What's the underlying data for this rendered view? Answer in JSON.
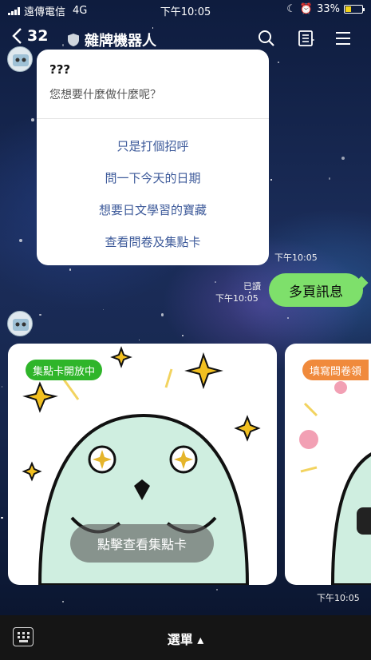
{
  "status": {
    "carrier": "遠傳電信",
    "network": "4G",
    "time": "下午10:05",
    "battery": "33%",
    "battery_fraction": 0.33
  },
  "header": {
    "unread_count": "32",
    "title": "雜牌機器人"
  },
  "quick_reply": {
    "title": "???",
    "subtitle": "您想要什麼做什麼呢？",
    "options": [
      "只是打個招呼",
      "問一下今天的日期",
      "想要日文學習的寶藏",
      "查看問卷及集點卡"
    ],
    "time": "下午10:05"
  },
  "user_message": {
    "text": "多頁訊息",
    "read": "已讀",
    "time": "下午10:05"
  },
  "carousel": {
    "cards": [
      {
        "tag": "集點卡開放中",
        "tag_color": "#2fb52a",
        "cta": "點擊查看集點卡"
      },
      {
        "tag": "填寫問卷領",
        "tag_color": "#f08a3c"
      }
    ],
    "time": "下午10:05"
  },
  "bottom_bar": {
    "menu_label": "選單 ▴"
  }
}
